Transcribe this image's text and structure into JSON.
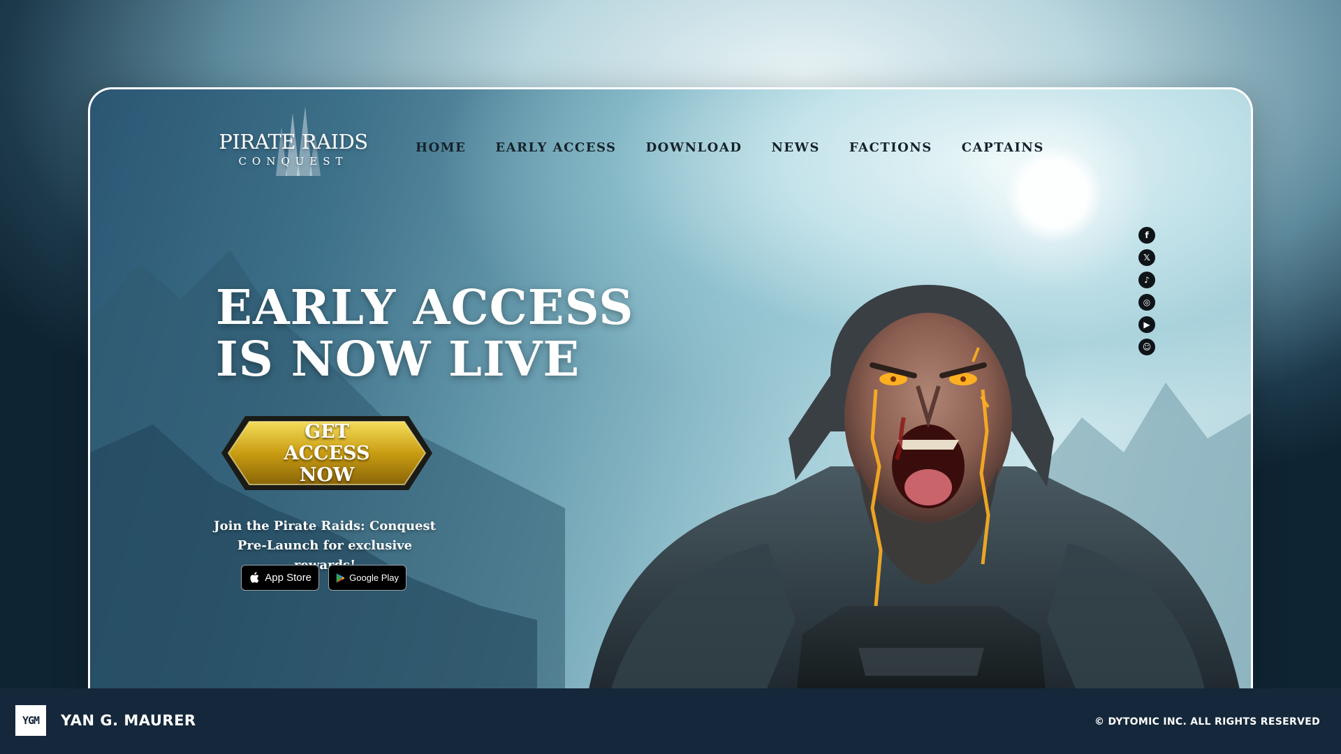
{
  "header": {
    "logo": {
      "title": "PIRATE RAIDS",
      "subtitle": "CONQUEST"
    },
    "nav": [
      {
        "label": "HOME"
      },
      {
        "label": "EARLY ACCESS"
      },
      {
        "label": "DOWNLOAD"
      },
      {
        "label": "NEWS"
      },
      {
        "label": "FACTIONS"
      },
      {
        "label": "CAPTAINS"
      }
    ]
  },
  "social": [
    {
      "icon": "facebook-icon",
      "glyph": "f"
    },
    {
      "icon": "x-icon",
      "glyph": "𝕏"
    },
    {
      "icon": "tiktok-icon",
      "glyph": "♪"
    },
    {
      "icon": "instagram-icon",
      "glyph": "◎"
    },
    {
      "icon": "youtube-icon",
      "glyph": "▶"
    },
    {
      "icon": "discord-icon",
      "glyph": "☺"
    }
  ],
  "hero": {
    "title_line1": "EARLY ACCESS",
    "title_line2": "IS NOW LIVE",
    "cta_label": "GET ACCESS NOW",
    "join_text": "Join the Pirate Raids: Conquest Pre-Launch for exclusive rewards!",
    "stores": {
      "apple": "App Store",
      "google": "Google Play"
    }
  },
  "footer": {
    "logo": "YGM",
    "name": "YAN G. MAURER",
    "copyright": "© DYTOMIC INC. ALL RIGHTS RESERVED"
  },
  "colors": {
    "accent_gold": "#d9b21a",
    "nav_text": "#15222a",
    "footer_bg": "#15273a",
    "rune_glow": "#ffb020"
  }
}
